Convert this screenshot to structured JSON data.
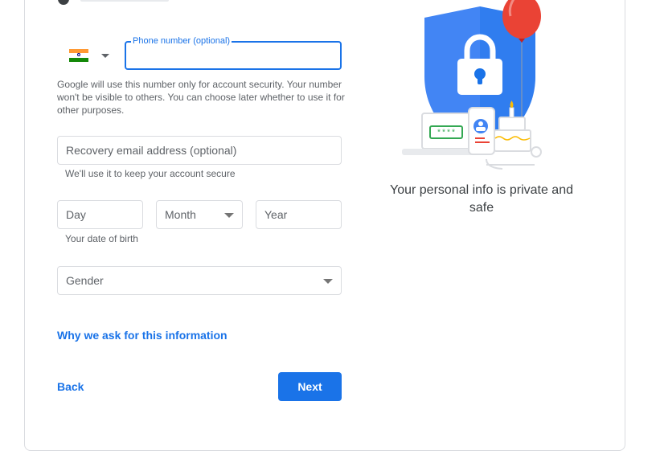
{
  "phone": {
    "label": "Phone number (optional)",
    "value": "",
    "country": "India",
    "helper": "Google will use this number only for account security. Your number won't be visible to others. You can choose later whether to use it for other purposes."
  },
  "recovery_email": {
    "placeholder": "Recovery email address (optional)",
    "helper": "We'll use it to keep your account secure"
  },
  "birth": {
    "day_placeholder": "Day",
    "month_placeholder": "Month",
    "year_placeholder": "Year",
    "helper": "Your date of birth"
  },
  "gender": {
    "placeholder": "Gender"
  },
  "links": {
    "why_ask": "Why we ask for this information",
    "back": "Back"
  },
  "buttons": {
    "next": "Next"
  },
  "side": {
    "caption": "Your personal info is private and safe",
    "password_mask": "****"
  },
  "colors": {
    "accent": "#1a73e8",
    "shield": "#4285f4",
    "balloon": "#ea4335",
    "border": "#dadce0",
    "helper_text": "#5f6368"
  }
}
